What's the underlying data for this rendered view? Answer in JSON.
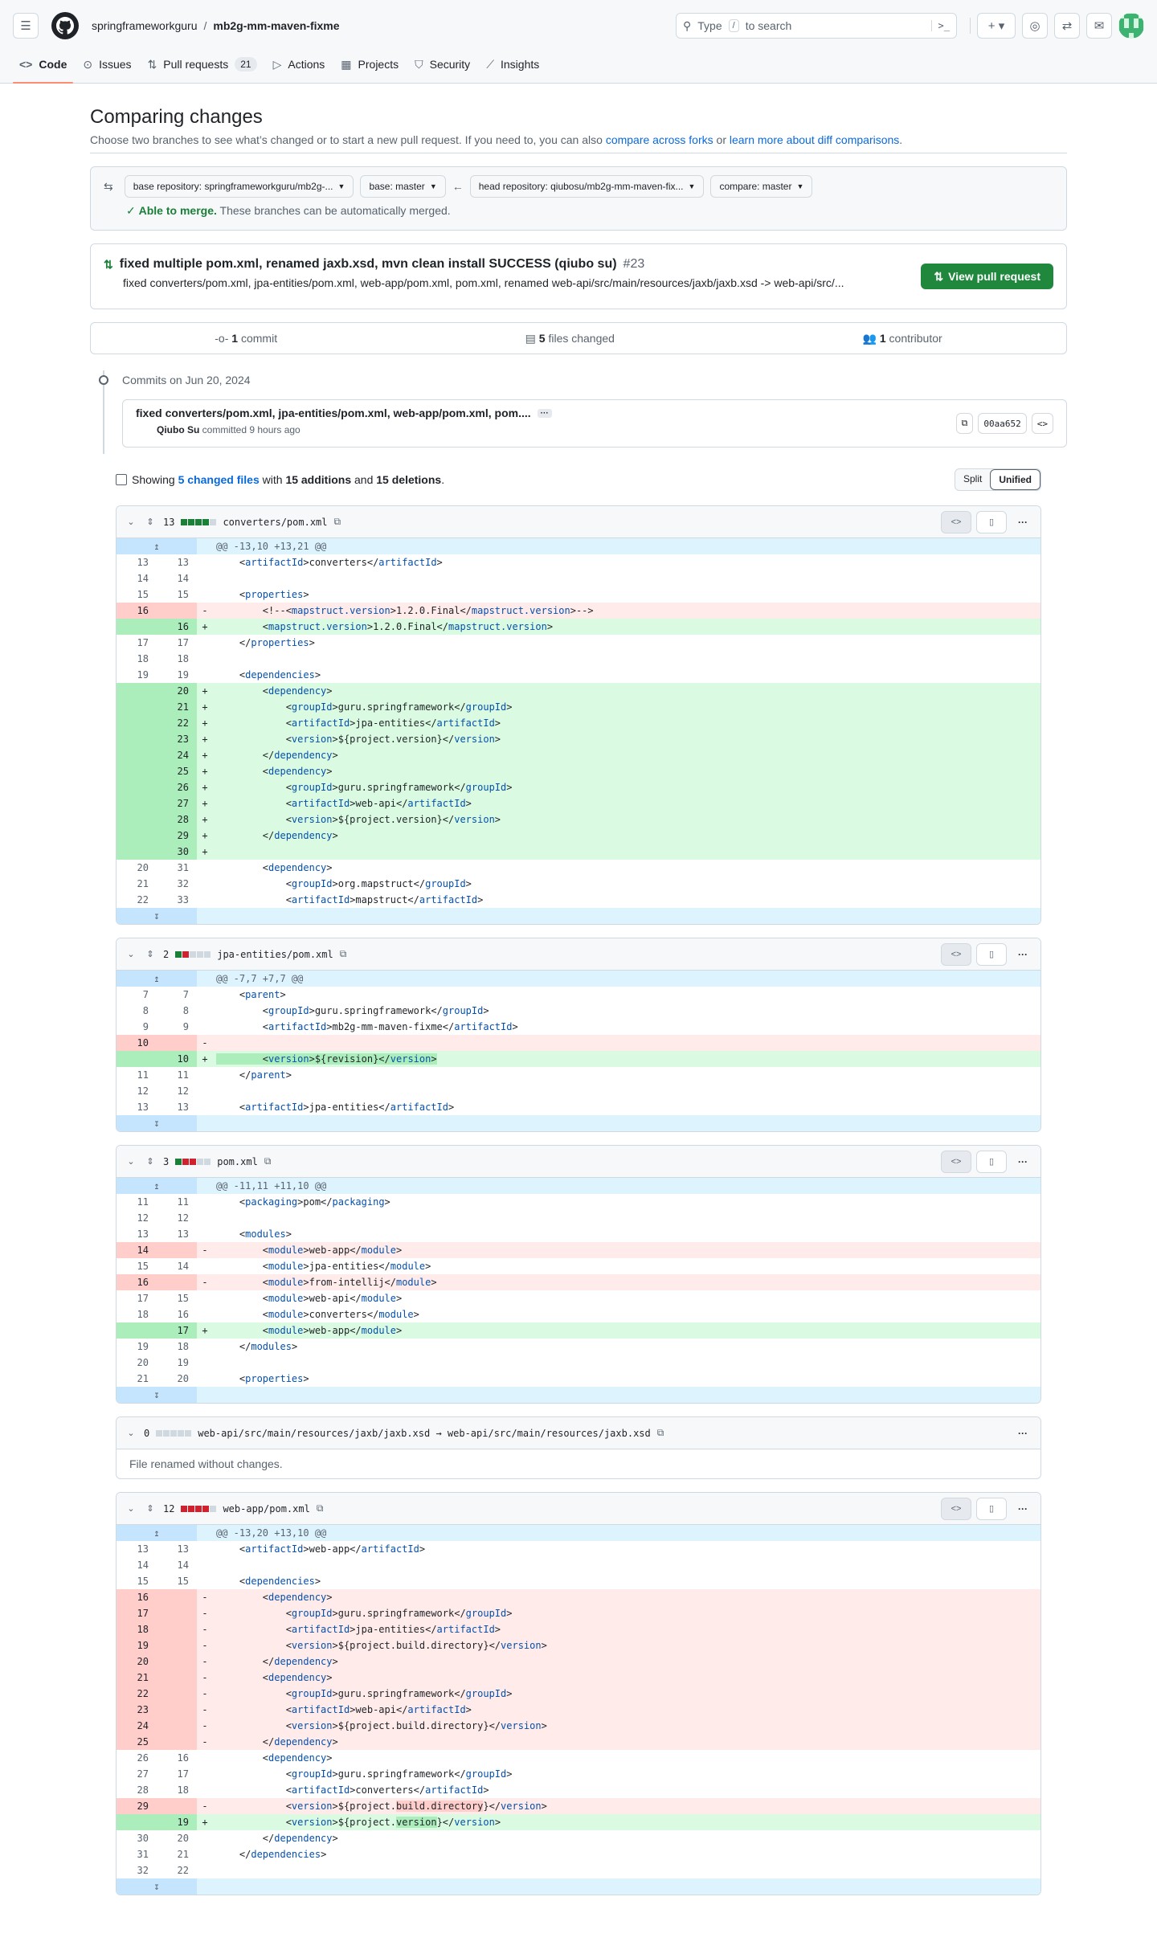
{
  "header": {
    "owner": "springframeworkguru",
    "repo": "mb2g-mm-maven-fixme",
    "search_before": "Type",
    "search_key": "/",
    "search_after": "to search"
  },
  "tabs": [
    {
      "label": "Code",
      "icon": "code-icon"
    },
    {
      "label": "Issues",
      "icon": "issue-icon"
    },
    {
      "label": "Pull requests",
      "icon": "pr-icon",
      "count": "21"
    },
    {
      "label": "Actions",
      "icon": "play-icon"
    },
    {
      "label": "Projects",
      "icon": "table-icon"
    },
    {
      "label": "Security",
      "icon": "shield-icon"
    },
    {
      "label": "Insights",
      "icon": "graph-icon"
    }
  ],
  "compare": {
    "title": "Comparing changes",
    "subtitle": "Choose two branches to see what’s changed or to start a new pull request. If you need to, you can also",
    "link1": "compare across forks",
    "or": "or",
    "link2": "learn more about diff comparisons",
    "base_repo": "base repository: springframeworkguru/mb2g-...",
    "base": "base: master",
    "head_repo": "head repository: qiubosu/mb2g-mm-maven-fix...",
    "compare_branch": "compare: master",
    "merge_ok": "Able to merge.",
    "merge_text": "These branches can be automatically merged."
  },
  "pr": {
    "title": "fixed multiple pom.xml, renamed jaxb.xsd, mvn clean install SUCCESS (qiubo su)",
    "number": "#23",
    "desc": "fixed converters/pom.xml, jpa-entities/pom.xml, web-app/pom.xml, pom.xml, renamed web-api/src/main/resources/jaxb/jaxb.xsd -> web-api/src/...",
    "button": "View pull request"
  },
  "stats": {
    "commits_n": "1",
    "commits_l": "commit",
    "files_n": "5",
    "files_l": "files changed",
    "contrib_n": "1",
    "contrib_l": "contributor"
  },
  "commits": {
    "date": "Commits on Jun 20, 2024",
    "title": "fixed converters/pom.xml, jpa-entities/pom.xml, web-app/pom.xml, pom....",
    "author": "Qiubo Su",
    "when": "committed 9 hours ago",
    "sha": "00aa652"
  },
  "summary": {
    "showing": "Showing",
    "files": "5 changed files",
    "with": "with",
    "additions": "15 additions",
    "and": "and",
    "deletions": "15 deletions",
    "split": "Split",
    "unified": "Unified"
  },
  "files": [
    {
      "count": "13",
      "blocks": [
        "g",
        "g",
        "g",
        "g",
        "n"
      ],
      "name": "converters/pom.xml",
      "hunk": "@@ -13,10 +13,21 @@",
      "lines": [
        [
          "c",
          "13",
          "13",
          "    <artifactId>converters</artifactId>"
        ],
        [
          "c",
          "14",
          "14",
          ""
        ],
        [
          "c",
          "15",
          "15",
          "    <properties>"
        ],
        [
          "d",
          "16",
          "",
          "        <!--<mapstruct.version>1.2.0.Final</mapstruct.version>-->"
        ],
        [
          "a",
          "",
          "16",
          "        <mapstruct.version>1.2.0.Final</mapstruct.version>"
        ],
        [
          "c",
          "17",
          "17",
          "    </properties>"
        ],
        [
          "c",
          "18",
          "18",
          ""
        ],
        [
          "c",
          "19",
          "19",
          "    <dependencies>"
        ],
        [
          "a",
          "",
          "20",
          "        <dependency>"
        ],
        [
          "a",
          "",
          "21",
          "            <groupId>guru.springframework</groupId>"
        ],
        [
          "a",
          "",
          "22",
          "            <artifactId>jpa-entities</artifactId>"
        ],
        [
          "a",
          "",
          "23",
          "            <version>${project.version}</version>"
        ],
        [
          "a",
          "",
          "24",
          "        </dependency>"
        ],
        [
          "a",
          "",
          "25",
          "        <dependency>"
        ],
        [
          "a",
          "",
          "26",
          "            <groupId>guru.springframework</groupId>"
        ],
        [
          "a",
          "",
          "27",
          "            <artifactId>web-api</artifactId>"
        ],
        [
          "a",
          "",
          "28",
          "            <version>${project.version}</version>"
        ],
        [
          "a",
          "",
          "29",
          "        </dependency>"
        ],
        [
          "a",
          "",
          "30",
          ""
        ],
        [
          "c",
          "20",
          "31",
          "        <dependency>"
        ],
        [
          "c",
          "21",
          "32",
          "            <groupId>org.mapstruct</groupId>"
        ],
        [
          "c",
          "22",
          "33",
          "            <artifactId>mapstruct</artifactId>"
        ]
      ]
    },
    {
      "count": "2",
      "blocks": [
        "g",
        "r",
        "n",
        "n",
        "n"
      ],
      "name": "jpa-entities/pom.xml",
      "hunk": "@@ -7,7 +7,7 @@",
      "lines": [
        [
          "c",
          "7",
          "7",
          "    <parent>"
        ],
        [
          "c",
          "8",
          "8",
          "        <groupId>guru.springframework</groupId>"
        ],
        [
          "c",
          "9",
          "9",
          "        <artifactId>mb2g-mm-maven-fixme</artifactId>"
        ],
        [
          "d",
          "10",
          "",
          ""
        ],
        [
          "a",
          "",
          "10",
          "        <version>${revision}</version>"
        ],
        [
          "c",
          "11",
          "11",
          "    </parent>"
        ],
        [
          "c",
          "12",
          "12",
          ""
        ],
        [
          "c",
          "13",
          "13",
          "    <artifactId>jpa-entities</artifactId>"
        ]
      ]
    },
    {
      "count": "3",
      "blocks": [
        "g",
        "r",
        "r",
        "n",
        "n"
      ],
      "name": "pom.xml",
      "hunk": "@@ -11,11 +11,10 @@",
      "lines": [
        [
          "c",
          "11",
          "11",
          "    <packaging>pom</packaging>"
        ],
        [
          "c",
          "12",
          "12",
          ""
        ],
        [
          "c",
          "13",
          "13",
          "    <modules>"
        ],
        [
          "d",
          "14",
          "",
          "        <module>web-app</module>"
        ],
        [
          "c",
          "15",
          "14",
          "        <module>jpa-entities</module>"
        ],
        [
          "d",
          "16",
          "",
          "        <module>from-intellij</module>"
        ],
        [
          "c",
          "17",
          "15",
          "        <module>web-api</module>"
        ],
        [
          "c",
          "18",
          "16",
          "        <module>converters</module>"
        ],
        [
          "a",
          "",
          "17",
          "        <module>web-app</module>"
        ],
        [
          "c",
          "19",
          "18",
          "    </modules>"
        ],
        [
          "c",
          "20",
          "19",
          ""
        ],
        [
          "c",
          "21",
          "20",
          "    <properties>"
        ]
      ]
    },
    {
      "count": "0",
      "blocks": [
        "n",
        "n",
        "n",
        "n",
        "n"
      ],
      "name": "web-api/src/main/resources/jaxb/jaxb.xsd → web-api/src/main/resources/jaxb.xsd",
      "renamed": "File renamed without changes."
    },
    {
      "count": "12",
      "blocks": [
        "r",
        "r",
        "r",
        "r",
        "n"
      ],
      "name": "web-app/pom.xml",
      "hunk": "@@ -13,20 +13,10 @@",
      "lines": [
        [
          "c",
          "13",
          "13",
          "    <artifactId>web-app</artifactId>"
        ],
        [
          "c",
          "14",
          "14",
          ""
        ],
        [
          "c",
          "15",
          "15",
          "    <dependencies>"
        ],
        [
          "d",
          "16",
          "",
          "        <dependency>"
        ],
        [
          "d",
          "17",
          "",
          "            <groupId>guru.springframework</groupId>"
        ],
        [
          "d",
          "18",
          "",
          "            <artifactId>jpa-entities</artifactId>"
        ],
        [
          "d",
          "19",
          "",
          "            <version>${project.build.directory}</version>"
        ],
        [
          "d",
          "20",
          "",
          "        </dependency>"
        ],
        [
          "d",
          "21",
          "",
          "        <dependency>"
        ],
        [
          "d",
          "22",
          "",
          "            <groupId>guru.springframework</groupId>"
        ],
        [
          "d",
          "23",
          "",
          "            <artifactId>web-api</artifactId>"
        ],
        [
          "d",
          "24",
          "",
          "            <version>${project.build.directory}</version>"
        ],
        [
          "d",
          "25",
          "",
          "        </dependency>"
        ],
        [
          "c",
          "26",
          "16",
          "        <dependency>"
        ],
        [
          "c",
          "27",
          "17",
          "            <groupId>guru.springframework</groupId>"
        ],
        [
          "c",
          "28",
          "18",
          "            <artifactId>converters</artifactId>"
        ],
        [
          "d",
          "29",
          "",
          "            <version>${project.build.directory}</version>"
        ],
        [
          "a",
          "",
          "19",
          "            <version>${project.version}</version>"
        ],
        [
          "c",
          "30",
          "20",
          "        </dependency>"
        ],
        [
          "c",
          "31",
          "21",
          "    </dependencies>"
        ],
        [
          "c",
          "32",
          "22",
          ""
        ]
      ]
    }
  ]
}
